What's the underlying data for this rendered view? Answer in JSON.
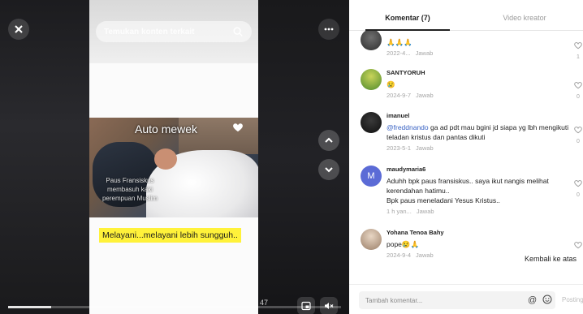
{
  "video": {
    "search_placeholder": "Temukan konten terkait",
    "frame_title": "Auto mewek",
    "frame_overlay": "Paus Fransiskus membasuh kaki perempuan Muslim",
    "caption": "Melayani...melayani lebih sungguh..",
    "time_label": "47",
    "progress": 0.13,
    "icons": [
      "close-icon",
      "more-icon",
      "search-icon",
      "chevron-up-icon",
      "chevron-down-icon",
      "pip-icon",
      "mute-icon",
      "heart-icon"
    ]
  },
  "panel": {
    "tabs": [
      {
        "label": "Komentar (7)",
        "active": true
      },
      {
        "label": "Video kreator",
        "active": false
      }
    ],
    "comments": [
      {
        "username": "",
        "text": "🙏🙏🙏",
        "date": "2022-4...",
        "reply": "Jawab",
        "likes": "1"
      },
      {
        "username": "SANTYORUH",
        "text": "😢",
        "date": "2024-9-7",
        "reply": "Jawab",
        "likes": "0"
      },
      {
        "username": "imanuel",
        "mention": "@freddnando",
        "text": " ga ad pdt mau bgini jd siapa yg lbh mengikuti teladan kristus dan pantas dikuti",
        "date": "2023-5-1",
        "reply": "Jawab",
        "likes": "0"
      },
      {
        "username": "maudymaria6",
        "avatar_letter": "M",
        "text": "Aduhh bpk paus fransiskus.. saya ikut nangis melihat kerendahan hatimu..\nBpk paus meneladani Yesus Kristus..",
        "date": "1 h yan...",
        "reply": "Jawab",
        "likes": "0"
      },
      {
        "username": "Yohana Tenoa Bahy",
        "text": "pope😢🙏",
        "date": "2024-9-4",
        "reply": "Jawab",
        "likes": ""
      }
    ],
    "back_to_top": "Kembali ke atas",
    "add_comment_placeholder": "Tambah komentar...",
    "post_label": "Posting"
  },
  "colors": {
    "caption_bg": "#fff23a",
    "mention": "#3a63c4",
    "avatar_m": "#5b6bd6"
  }
}
